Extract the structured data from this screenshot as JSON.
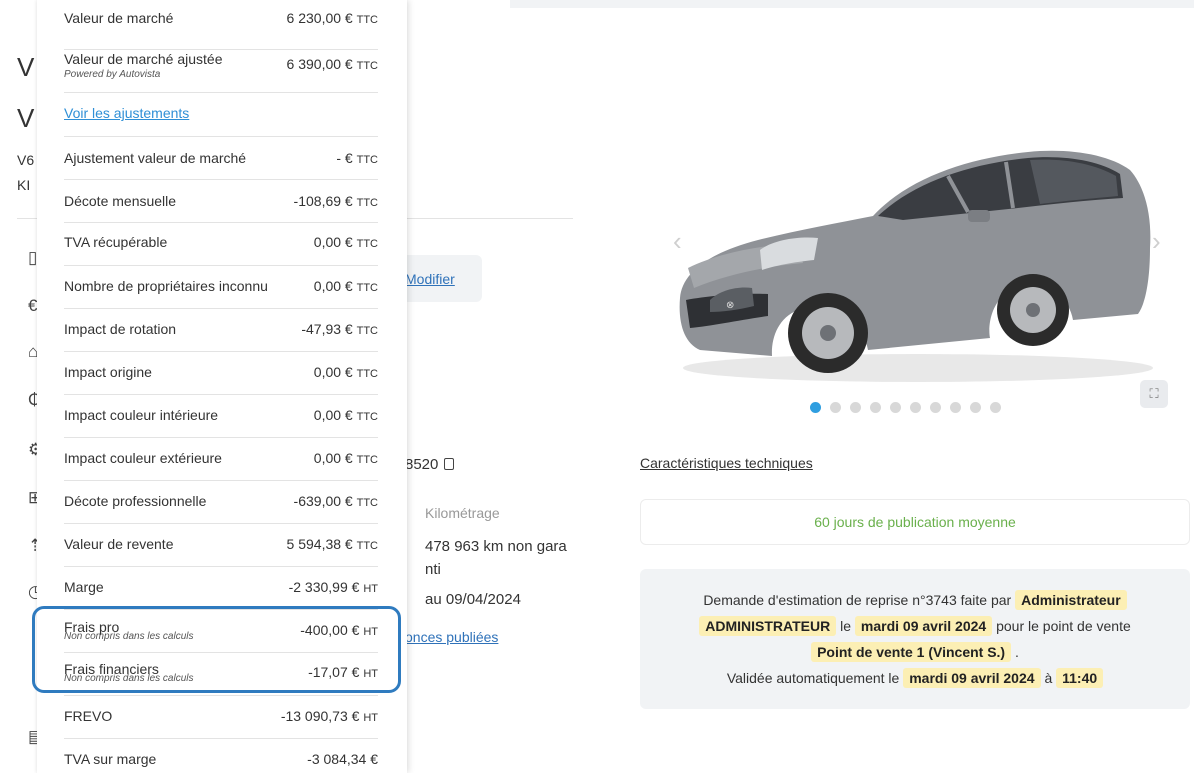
{
  "background": {
    "title_line1": "V",
    "title_line2": "V",
    "sub1": "V6",
    "sub2": "KI",
    "modifier_link": "Modifier",
    "immat_suffix": "8520",
    "kilometrage_label": "Kilométrage",
    "kilometrage_line1": "478 963 km non gara",
    "kilometrage_line2": "nti",
    "date_line": "au 09/04/2024",
    "annonces_link": "onces publiées"
  },
  "right": {
    "carousel_dots": 10,
    "caracteristiques_link": "Caractéristiques techniques",
    "publication": "60 jours de publication moyenne",
    "demande": {
      "text1": "Demande d'estimation de reprise n°3743 faite par",
      "requester_first": "Administrateur",
      "requester_last": "ADMINISTRATEUR",
      "le": "le",
      "date": "mardi 09 avril 2024",
      "pour": "pour le point de vente",
      "point_de_vente": "Point de vente 1 (Vincent S.)",
      "dot": ".",
      "validee": "Validée automatiquement le",
      "validee_date": "mardi 09 avril 2024",
      "a": "à",
      "heure": "11:40"
    }
  },
  "panel": {
    "rows": [
      {
        "label": "Valeur de marché",
        "amount": "6 230,00 €",
        "unit": "TTC"
      },
      {
        "label": "Valeur de marché ajustée",
        "sub": "Powered by Autovista",
        "amount": "6 390,00 €",
        "unit": "TTC"
      },
      {
        "label": "Voir les ajustements"
      },
      {
        "label": "Ajustement valeur de marché",
        "amount": "- €",
        "unit": "TTC"
      },
      {
        "label": "Décote mensuelle",
        "amount": "-108,69 €",
        "unit": "TTC"
      },
      {
        "label": "TVA récupérable",
        "amount": "0,00 €",
        "unit": "TTC"
      },
      {
        "label": "Nombre de propriétaires inconnu",
        "amount": "0,00 €",
        "unit": "TTC"
      },
      {
        "label": "Impact de rotation",
        "amount": "-47,93 €",
        "unit": "TTC"
      },
      {
        "label": "Impact origine",
        "amount": "0,00 €",
        "unit": "TTC"
      },
      {
        "label": "Impact couleur intérieure",
        "amount": "0,00 €",
        "unit": "TTC"
      },
      {
        "label": "Impact couleur extérieure",
        "amount": "0,00 €",
        "unit": "TTC"
      },
      {
        "label": "Décote professionnelle",
        "amount": "-639,00 €",
        "unit": "TTC"
      },
      {
        "label": "Valeur de revente",
        "amount": "5 594,38 €",
        "unit": "TTC"
      },
      {
        "label": "Marge",
        "amount": "-2 330,99 €",
        "unit": "HT"
      },
      {
        "label": "Frais pro",
        "sub": "Non compris dans les calculs",
        "amount": "-400,00 €",
        "unit": "HT"
      },
      {
        "label": "Frais financiers",
        "sub": "Non compris dans les calculs",
        "amount": "-17,07 €",
        "unit": "HT"
      },
      {
        "label": "FREVO",
        "amount": "-13 090,73 €",
        "unit": "HT"
      },
      {
        "label": "TVA sur marge",
        "amount": "-3 084,34 €",
        "unit": ""
      }
    ]
  }
}
